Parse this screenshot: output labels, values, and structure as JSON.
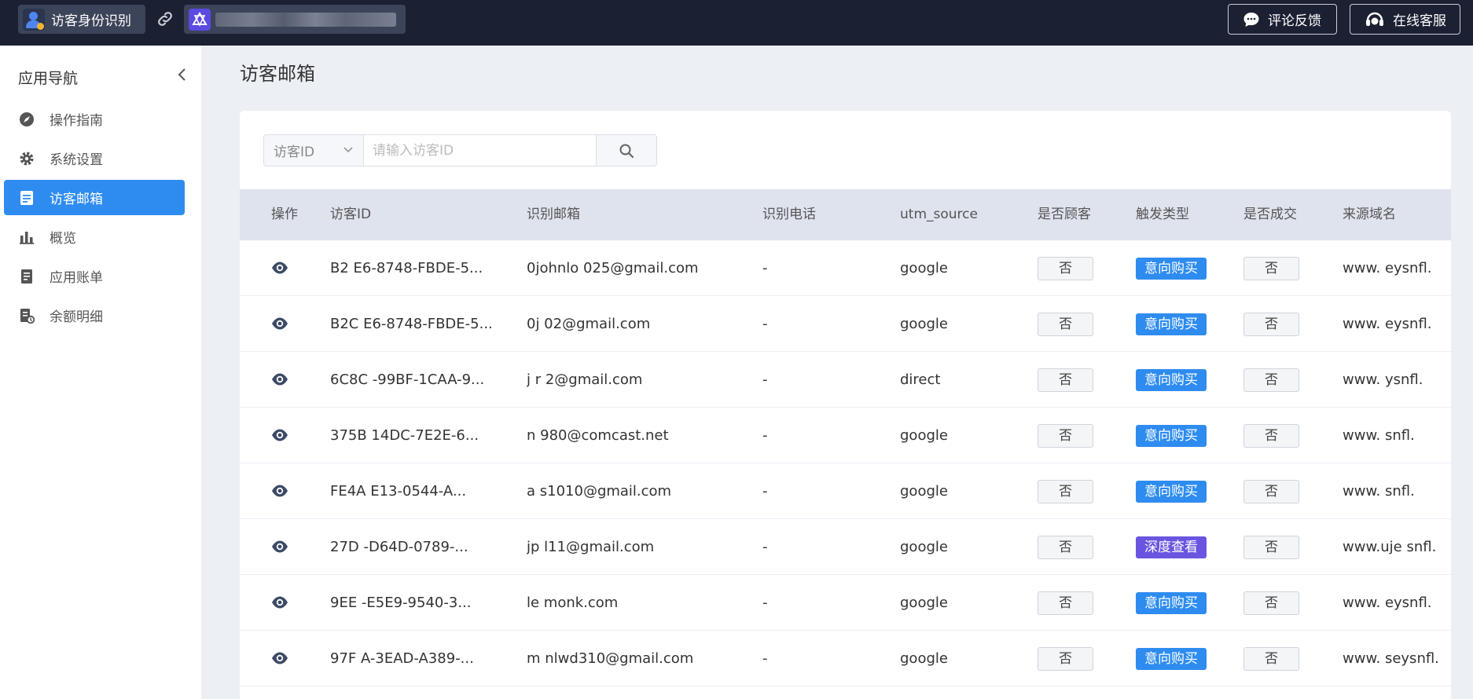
{
  "topbar": {
    "app_title": "访客身份识别",
    "feedback_label": "评论反馈",
    "service_label": "在线客服"
  },
  "sidebar": {
    "title": "应用导航",
    "items": [
      {
        "label": "操作指南",
        "icon": "navigation-icon"
      },
      {
        "label": "系统设置",
        "icon": "gear-icon"
      },
      {
        "label": "访客邮箱",
        "icon": "document-icon",
        "active": true
      },
      {
        "label": "概览",
        "icon": "bar-chart-icon"
      },
      {
        "label": "应用账单",
        "icon": "bill-icon"
      },
      {
        "label": "余额明细",
        "icon": "balance-icon"
      }
    ]
  },
  "main": {
    "title": "访客邮箱",
    "search": {
      "select_value": "访客ID",
      "placeholder": "请输入访客ID"
    },
    "columns": [
      "操作",
      "访客ID",
      "识别邮箱",
      "识别电话",
      "utm_source",
      "是否顾客",
      "触发类型",
      "是否成交",
      "来源域名"
    ],
    "rows": [
      {
        "id": "B2      E6-8748-FBDE-5...",
        "email": "0johnlo      025@gmail.com",
        "phone": "-",
        "utm": "google",
        "customer": "否",
        "trigger": "意向购买",
        "deal": "否",
        "domain": "www.       eysnfl."
      },
      {
        "id": "B2C     E6-8748-FBDE-5...",
        "email": "0j         02@gmail.com",
        "phone": "-",
        "utm": "google",
        "customer": "否",
        "trigger": "意向购买",
        "deal": "否",
        "domain": "www.       eysnfl."
      },
      {
        "id": "6C8C      -99BF-1CAA-9...",
        "email": "j    r   2@gmail.com",
        "phone": "-",
        "utm": "direct",
        "customer": "否",
        "trigger": "意向购买",
        "deal": "否",
        "domain": "www.      ysnfl."
      },
      {
        "id": "375B      14DC-7E2E-6...",
        "email": "n       980@comcast.net",
        "phone": "-",
        "utm": "google",
        "customer": "否",
        "trigger": "意向购买",
        "deal": "否",
        "domain": "www.       snfl."
      },
      {
        "id": "FE4A       E13-0544-A...",
        "email": "a        s1010@gmail.com",
        "phone": "-",
        "utm": "google",
        "customer": "否",
        "trigger": "意向购买",
        "deal": "否",
        "domain": "www.       snfl."
      },
      {
        "id": "27D       -D64D-0789-...",
        "email": "jp      l11@gmail.com",
        "phone": "-",
        "utm": "google",
        "customer": "否",
        "trigger": "深度查看",
        "deal": "否",
        "domain": "www.uje     snfl."
      },
      {
        "id": "9EE     -E5E9-9540-3...",
        "email": "le       monk.com",
        "phone": "-",
        "utm": "google",
        "customer": "否",
        "trigger": "意向购买",
        "deal": "否",
        "domain": "www.     eysnfl."
      },
      {
        "id": "97F      A-3EAD-A389-...",
        "email": "m       nlwd310@gmail.com",
        "phone": "-",
        "utm": "google",
        "customer": "否",
        "trigger": "意向购买",
        "deal": "否",
        "domain": "www.      seysnfl."
      }
    ]
  },
  "colors": {
    "topbar_bg": "#1b2033",
    "accent": "#2e8cf0",
    "trigger_intent": "#2e8cf0",
    "trigger_deep": "#6a55e0"
  }
}
